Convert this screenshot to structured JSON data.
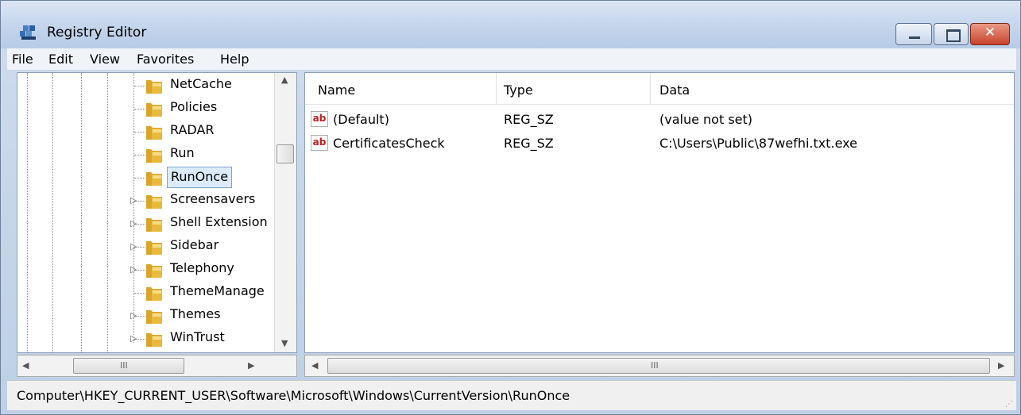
{
  "window": {
    "title": "Registry Editor"
  },
  "menu": [
    "File",
    "Edit",
    "View",
    "Favorites",
    "Help"
  ],
  "tree": {
    "items": [
      {
        "label": "NetCache",
        "expandable": false
      },
      {
        "label": "Policies",
        "expandable": false
      },
      {
        "label": "RADAR",
        "expandable": false
      },
      {
        "label": "Run",
        "expandable": false
      },
      {
        "label": "RunOnce",
        "expandable": false,
        "selected": true
      },
      {
        "label": "Screensavers",
        "expandable": true
      },
      {
        "label": "Shell Extension",
        "expandable": true
      },
      {
        "label": "Sidebar",
        "expandable": true
      },
      {
        "label": "Telephony",
        "expandable": true
      },
      {
        "label": "ThemeManage",
        "expandable": false
      },
      {
        "label": "Themes",
        "expandable": true
      },
      {
        "label": "WinTrust",
        "expandable": true
      }
    ]
  },
  "list": {
    "columns": [
      "Name",
      "Type",
      "Data"
    ],
    "rows": [
      {
        "icon": "string-value-icon",
        "icon_text": "ab",
        "name": "(Default)",
        "type": "REG_SZ",
        "data": "(value not set)"
      },
      {
        "icon": "string-value-icon",
        "icon_text": "ab",
        "name": "CertificatesCheck",
        "type": "REG_SZ",
        "data": "C:\\Users\\Public\\87wefhi.txt.exe"
      }
    ]
  },
  "scroll": {
    "grip": "III"
  },
  "status": {
    "path": "Computer\\HKEY_CURRENT_USER\\Software\\Microsoft\\Windows\\CurrentVersion\\RunOnce"
  },
  "colors": {
    "selection": "#dcebfc",
    "selection_border": "#7da2ce",
    "folder": "#e8b93a",
    "close_button": "#c8412b"
  }
}
